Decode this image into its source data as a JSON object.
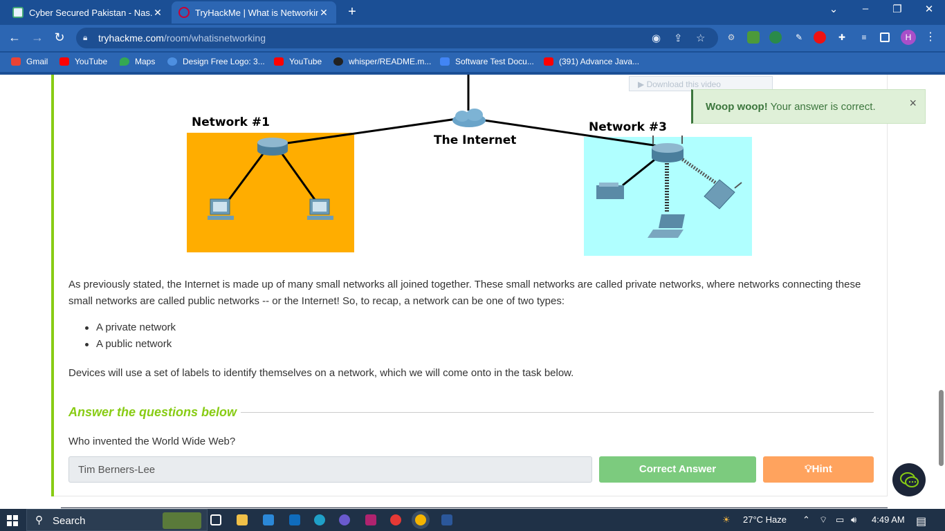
{
  "browser": {
    "tabs": [
      {
        "title": "Cyber Secured Pakistan - Nas.io I",
        "active": false
      },
      {
        "title": "TryHackMe | What is Networking",
        "active": true
      }
    ],
    "url_host": "tryhackme.com",
    "url_path": "/room/whatisnetworking",
    "bookmarks": [
      {
        "label": "Gmail",
        "color": "#ea4335"
      },
      {
        "label": "YouTube",
        "color": "#ff0000"
      },
      {
        "label": "Maps",
        "color": "#34a853"
      },
      {
        "label": "Design Free Logo: 3...",
        "color": "#4d8fe0"
      },
      {
        "label": "YouTube",
        "color": "#ff0000"
      },
      {
        "label": "whisper/README.m...",
        "color": "#222222"
      },
      {
        "label": "Software Test Docu...",
        "color": "#4285f4"
      },
      {
        "label": "(391) Advance Java...",
        "color": "#ff0000"
      }
    ],
    "profile_initial": "H"
  },
  "diagram": {
    "network1_label": "Network #1",
    "internet_label": "The Internet",
    "network3_label": "Network #3",
    "download_overlay": "Download this video",
    "network1_color": "#ffad00",
    "network3_color": "#b0ffff"
  },
  "toast": {
    "strong": "Woop woop!",
    "message": " Your answer is correct.",
    "close": "×"
  },
  "content": {
    "paragraph1": "As previously stated, the Internet is made up of many small networks all joined together.  These small networks are called private networks, where networks connecting these small networks are called public networks -- or the Internet! So, to recap, a network can be one of two types:",
    "bullets": [
      "A private network",
      "A public network"
    ],
    "paragraph2": "Devices will use a set of labels to identify themselves on a network, which we will come onto in the task below."
  },
  "answers": {
    "heading": "Answer the questions below",
    "question": "Who invented the World Wide Web?",
    "answer_value": "Tim Berners-Lee",
    "correct_button": "Correct Answer",
    "hint_button": "Hint"
  },
  "taskbar": {
    "search_label": "Search",
    "weather": "27°C  Haze",
    "time": "4:49 AM"
  },
  "colors": {
    "accent_green": "#88cc14",
    "correct_green": "#7ccb7e",
    "hint_orange": "#ffa35e"
  }
}
